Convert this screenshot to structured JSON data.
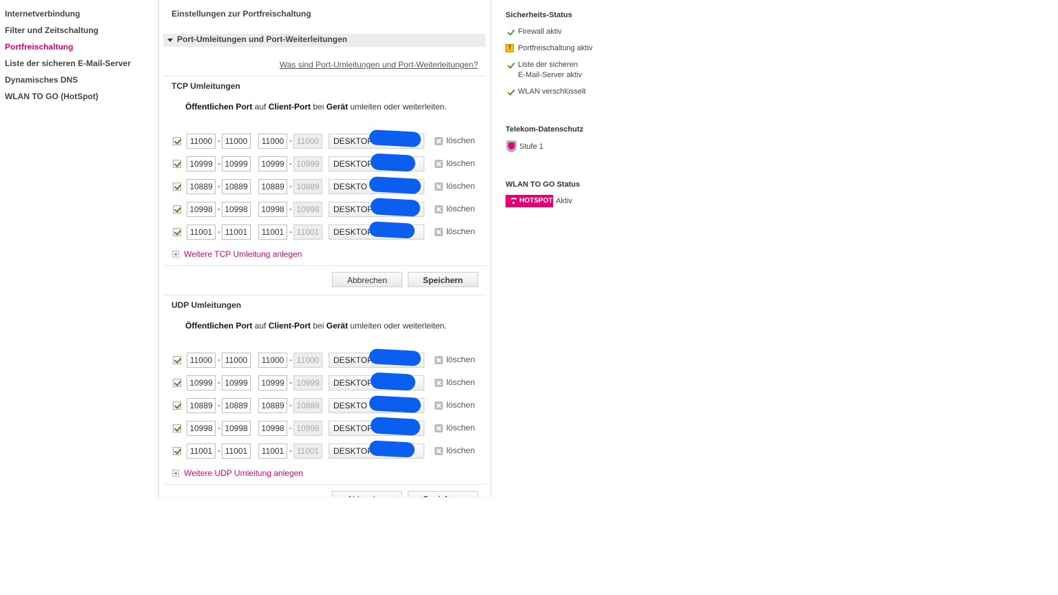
{
  "nav": [
    {
      "label": "Internetverbindung",
      "active": false
    },
    {
      "label": "Filter und Zeitschaltung",
      "active": false
    },
    {
      "label": "Portfreischaltung",
      "active": true
    },
    {
      "label": "Liste der sicheren E-Mail-Server",
      "active": false
    },
    {
      "label": "Dynamisches DNS",
      "active": false
    },
    {
      "label": "WLAN TO GO (HotSpot)",
      "active": false
    }
  ],
  "panel": {
    "title": "Einstellungen zur Portfreischaltung",
    "section_title": "Port-Umleitungen und Port-Weiterleitungen",
    "help_link": "Was sind Port-Umleitungen und Port-Weiterleitungen?"
  },
  "tcp": {
    "title": "TCP Umleitungen",
    "desc_p1": "Öffentlichen Port",
    "desc_t1": " auf ",
    "desc_p2": "Client-Port",
    "desc_t2": " bei ",
    "desc_p3": "Gerät",
    "desc_t3": " umleiten oder weiterleiten.",
    "rows": [
      {
        "pub_from": "11000",
        "pub_to": "11000",
        "cli_from": "11000",
        "cli_to": "11000",
        "device": "DESKTOP",
        "checked": true
      },
      {
        "pub_from": "10999",
        "pub_to": "10999",
        "cli_from": "10999",
        "cli_to": "10999",
        "device": "DESKTOP",
        "checked": true
      },
      {
        "pub_from": "10889",
        "pub_to": "10889",
        "cli_from": "10889",
        "cli_to": "10889",
        "device": "DESKTO",
        "checked": true
      },
      {
        "pub_from": "10998",
        "pub_to": "10998",
        "cli_from": "10998",
        "cli_to": "10998",
        "device": "DESKTOP",
        "checked": true
      },
      {
        "pub_from": "11001",
        "pub_to": "11001",
        "cli_from": "11001",
        "cli_to": "11001",
        "device": "DESKTOP",
        "checked": true
      }
    ],
    "add_label": "Weitere TCP Umleitung anlegen"
  },
  "udp": {
    "title": "UDP Umleitungen",
    "desc_p1": "Öffentlichen Port",
    "desc_t1": " auf ",
    "desc_p2": "Client-Port",
    "desc_t2": " bei ",
    "desc_p3": "Gerät",
    "desc_t3": " umleiten oder weiterleiten.",
    "rows": [
      {
        "pub_from": "11000",
        "pub_to": "11000",
        "cli_from": "11000",
        "cli_to": "11000",
        "device": "DESKTOP-",
        "checked": true
      },
      {
        "pub_from": "10999",
        "pub_to": "10999",
        "cli_from": "10999",
        "cli_to": "10999",
        "device": "DESKTOP",
        "checked": true
      },
      {
        "pub_from": "10889",
        "pub_to": "10889",
        "cli_from": "10889",
        "cli_to": "10889",
        "device": "DESKTO",
        "checked": true
      },
      {
        "pub_from": "10998",
        "pub_to": "10998",
        "cli_from": "10998",
        "cli_to": "10998",
        "device": "DESKTOP",
        "checked": true
      },
      {
        "pub_from": "11001",
        "pub_to": "11001",
        "cli_from": "11001",
        "cli_to": "11001",
        "device": "DESKTOP",
        "checked": true
      }
    ],
    "add_label": "Weitere UDP Umleitung anlegen"
  },
  "delete_label": "löschen",
  "buttons": {
    "cancel": "Abbrechen",
    "save": "Speichern"
  },
  "right": {
    "security_title": "Sicherheits-Status",
    "security_items": [
      {
        "icon": "check-icon",
        "text": "Firewall aktiv"
      },
      {
        "icon": "warning-icon",
        "text": "Portfreischaltung aktiv"
      },
      {
        "icon": "check-icon",
        "text": "Liste der sicheren\nE-Mail-Server aktiv"
      },
      {
        "icon": "check-icon",
        "text": "WLAN verschlüsselt"
      }
    ],
    "privacy_title": "Telekom-Datenschutz",
    "privacy_level": "Stufe 1",
    "wlan_title": "WLAN TO GO Status",
    "hotspot_badge": "HOTSPOT",
    "hotspot_status": "Aktiv"
  },
  "colors": {
    "accent": "#c7087a",
    "brand": "#e20074",
    "redaction": "#0a5ff0"
  }
}
